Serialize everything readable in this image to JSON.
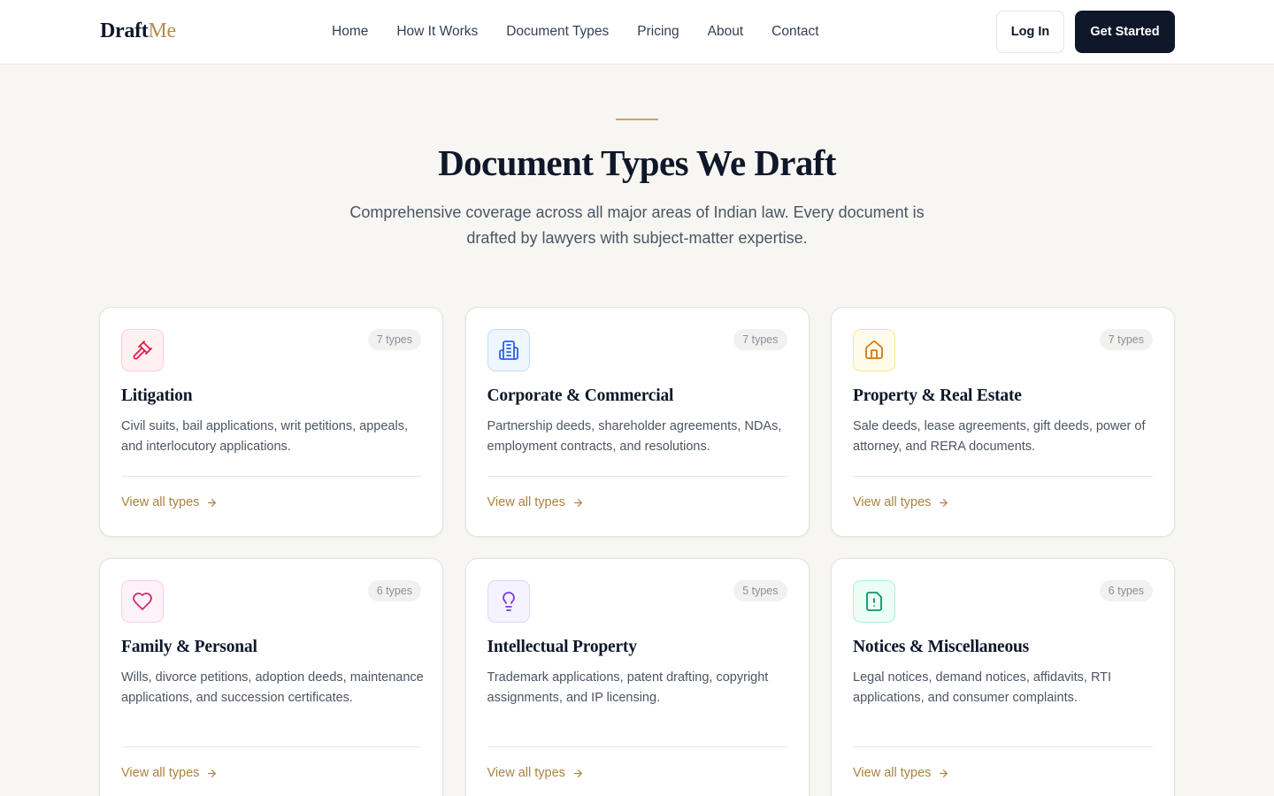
{
  "header": {
    "logo_main": "Draft",
    "logo_accent": "Me",
    "nav": [
      "Home",
      "How It Works",
      "Document Types",
      "Pricing",
      "About",
      "Contact"
    ],
    "login_label": "Log In",
    "cta_label": "Get Started"
  },
  "hero": {
    "title": "Document Types We Draft",
    "subtitle": "Comprehensive coverage across all major areas of Indian law. Every document is drafted by lawyers with subject-matter expertise."
  },
  "cards": [
    {
      "icon": "gavel-icon",
      "color": "#e11d48",
      "bg": "#fff1f2",
      "border": "#fecdd3",
      "badge": "7 types",
      "title": "Litigation",
      "desc": "Civil suits, bail applications, writ petitions, appeals, and interlocutory applications.",
      "link": "View all types"
    },
    {
      "icon": "building-icon",
      "color": "#2563eb",
      "bg": "#eff6ff",
      "border": "#bfdbfe",
      "badge": "7 types",
      "title": "Corporate & Commercial",
      "desc": "Partnership deeds, shareholder agreements, NDAs, employment contracts, and resolutions.",
      "link": "View all types"
    },
    {
      "icon": "home-icon",
      "color": "#d97706",
      "bg": "#fffbeb",
      "border": "#fde68a",
      "badge": "7 types",
      "title": "Property & Real Estate",
      "desc": "Sale deeds, lease agreements, gift deeds, power of attorney, and RERA documents.",
      "link": "View all types"
    },
    {
      "icon": "heart-icon",
      "color": "#db2777",
      "bg": "#fdf2f8",
      "border": "#fbcfe8",
      "badge": "6 types",
      "title": "Family & Personal",
      "desc": "Wills, divorce petitions, adoption deeds, maintenance applications, and succession certificates.",
      "link": "View all types"
    },
    {
      "icon": "lightbulb-icon",
      "color": "#7c3aed",
      "bg": "#f5f3ff",
      "border": "#ddd6fe",
      "badge": "5 types",
      "title": "Intellectual Property",
      "desc": "Trademark applications, patent drafting, copyright assignments, and IP licensing.",
      "link": "View all types"
    },
    {
      "icon": "file-alert-icon",
      "color": "#059669",
      "bg": "#ecfdf5",
      "border": "#a7f3d0",
      "badge": "6 types",
      "title": "Notices & Miscellaneous",
      "desc": "Legal notices, demand notices, affidavits, RTI applications, and consumer complaints.",
      "link": "View all types"
    }
  ]
}
